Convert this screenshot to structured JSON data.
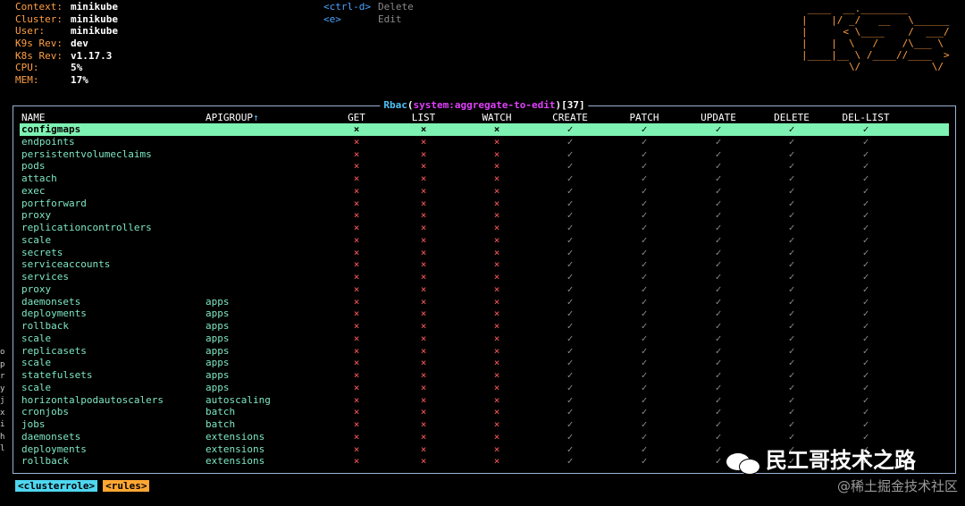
{
  "header": {
    "info": [
      {
        "key": "Context:",
        "value": "minikube"
      },
      {
        "key": "Cluster:",
        "value": "minikube"
      },
      {
        "key": "User:",
        "value": "minikube"
      },
      {
        "key": "K9s Rev:",
        "value": "dev"
      },
      {
        "key": "K8s Rev:",
        "value": "v1.17.3"
      },
      {
        "key": "CPU:",
        "value": "5%"
      },
      {
        "key": "MEM:",
        "value": "17%"
      }
    ],
    "shortcuts": [
      {
        "key": "<ctrl-d>",
        "action": "Delete"
      },
      {
        "key": "<e>",
        "action": "Edit"
      }
    ],
    "logo_icon": "k9s-ascii-logo"
  },
  "table": {
    "title": {
      "kind": "Rbac",
      "open": "(",
      "name": "system:aggregate-to-edit",
      "close": ")",
      "count": "[37]"
    },
    "columns": {
      "name": "NAME",
      "apigroup": "APIGROUP",
      "sort_indicator": "↑",
      "verbs": [
        "GET",
        "LIST",
        "WATCH",
        "CREATE",
        "PATCH",
        "UPDATE",
        "DELETE",
        "DEL-LIST"
      ]
    },
    "marks": {
      "deny": "×",
      "allow": "✓"
    },
    "selected_index": 0,
    "rows": [
      {
        "name": "configmaps",
        "apigroup": "",
        "perms": [
          0,
          0,
          0,
          1,
          1,
          1,
          1,
          1
        ]
      },
      {
        "name": "endpoints",
        "apigroup": "",
        "perms": [
          0,
          0,
          0,
          1,
          1,
          1,
          1,
          1
        ]
      },
      {
        "name": "persistentvolumeclaims",
        "apigroup": "",
        "perms": [
          0,
          0,
          0,
          1,
          1,
          1,
          1,
          1
        ]
      },
      {
        "name": "pods",
        "apigroup": "",
        "perms": [
          0,
          0,
          0,
          1,
          1,
          1,
          1,
          1
        ]
      },
      {
        "name": "attach",
        "apigroup": "",
        "perms": [
          0,
          0,
          0,
          1,
          1,
          1,
          1,
          1
        ]
      },
      {
        "name": "exec",
        "apigroup": "",
        "perms": [
          0,
          0,
          0,
          1,
          1,
          1,
          1,
          1
        ]
      },
      {
        "name": "portforward",
        "apigroup": "",
        "perms": [
          0,
          0,
          0,
          1,
          1,
          1,
          1,
          1
        ]
      },
      {
        "name": "proxy",
        "apigroup": "",
        "perms": [
          0,
          0,
          0,
          1,
          1,
          1,
          1,
          1
        ]
      },
      {
        "name": "replicationcontrollers",
        "apigroup": "",
        "perms": [
          0,
          0,
          0,
          1,
          1,
          1,
          1,
          1
        ]
      },
      {
        "name": "scale",
        "apigroup": "",
        "perms": [
          0,
          0,
          0,
          1,
          1,
          1,
          1,
          1
        ]
      },
      {
        "name": "secrets",
        "apigroup": "",
        "perms": [
          0,
          0,
          0,
          1,
          1,
          1,
          1,
          1
        ]
      },
      {
        "name": "serviceaccounts",
        "apigroup": "",
        "perms": [
          0,
          0,
          0,
          1,
          1,
          1,
          1,
          1
        ]
      },
      {
        "name": "services",
        "apigroup": "",
        "perms": [
          0,
          0,
          0,
          1,
          1,
          1,
          1,
          1
        ]
      },
      {
        "name": "proxy",
        "apigroup": "",
        "perms": [
          0,
          0,
          0,
          1,
          1,
          1,
          1,
          1
        ]
      },
      {
        "name": "daemonsets",
        "apigroup": "apps",
        "perms": [
          0,
          0,
          0,
          1,
          1,
          1,
          1,
          1
        ]
      },
      {
        "name": "deployments",
        "apigroup": "apps",
        "perms": [
          0,
          0,
          0,
          1,
          1,
          1,
          1,
          1
        ]
      },
      {
        "name": "rollback",
        "apigroup": "apps",
        "perms": [
          0,
          0,
          0,
          1,
          1,
          1,
          1,
          1
        ]
      },
      {
        "name": "scale",
        "apigroup": "apps",
        "perms": [
          0,
          0,
          0,
          1,
          1,
          1,
          1,
          1
        ]
      },
      {
        "name": "replicasets",
        "apigroup": "apps",
        "perms": [
          0,
          0,
          0,
          1,
          1,
          1,
          1,
          1
        ]
      },
      {
        "name": "scale",
        "apigroup": "apps",
        "perms": [
          0,
          0,
          0,
          1,
          1,
          1,
          1,
          1
        ]
      },
      {
        "name": "statefulsets",
        "apigroup": "apps",
        "perms": [
          0,
          0,
          0,
          1,
          1,
          1,
          1,
          1
        ]
      },
      {
        "name": "scale",
        "apigroup": "apps",
        "perms": [
          0,
          0,
          0,
          1,
          1,
          1,
          1,
          1
        ]
      },
      {
        "name": "horizontalpodautoscalers",
        "apigroup": "autoscaling",
        "perms": [
          0,
          0,
          0,
          1,
          1,
          1,
          1,
          1
        ]
      },
      {
        "name": "cronjobs",
        "apigroup": "batch",
        "perms": [
          0,
          0,
          0,
          1,
          1,
          1,
          1,
          1
        ]
      },
      {
        "name": "jobs",
        "apigroup": "batch",
        "perms": [
          0,
          0,
          0,
          1,
          1,
          1,
          1,
          1
        ]
      },
      {
        "name": "daemonsets",
        "apigroup": "extensions",
        "perms": [
          0,
          0,
          0,
          1,
          1,
          1,
          1,
          1
        ]
      },
      {
        "name": "deployments",
        "apigroup": "extensions",
        "perms": [
          0,
          0,
          0,
          1,
          1,
          1,
          1,
          1
        ]
      },
      {
        "name": "rollback",
        "apigroup": "extensions",
        "perms": [
          0,
          0,
          0,
          1,
          1,
          1,
          1,
          1
        ]
      }
    ]
  },
  "breadcrumbs": [
    "<clusterrole>",
    "<rules>"
  ],
  "watermarks": {
    "main": "民工哥技术之路",
    "icon": "wechat-icon",
    "site": "@稀土掘金技术社区"
  },
  "left_edge": [
    "o",
    "p",
    "r",
    "y",
    "j",
    "x",
    "i",
    "h",
    "l"
  ],
  "colors": {
    "accent": "#ff9f43",
    "selection": "#7ef2b3",
    "deny": "#ff5a5a",
    "allow": "#8c8c8c",
    "border": "#9bb3d6",
    "title": "#4fc3f7",
    "namespace": "#e040fb"
  }
}
